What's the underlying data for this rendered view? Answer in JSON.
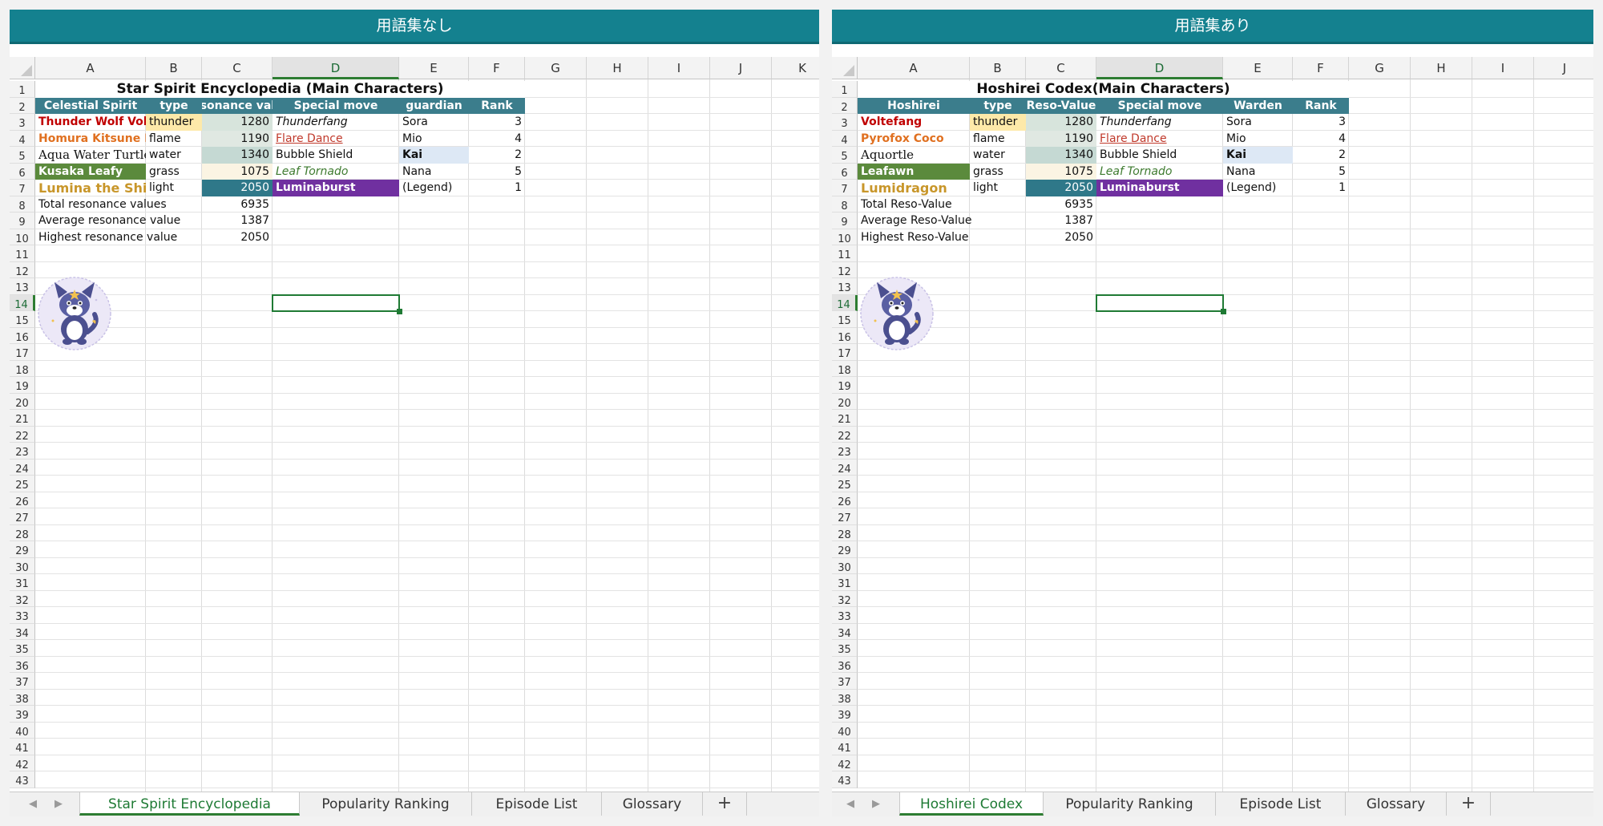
{
  "panels": [
    {
      "title": "用語集なし",
      "columns": [
        "A",
        "B",
        "C",
        "D",
        "E",
        "F",
        "G",
        "H",
        "I",
        "J",
        "K"
      ],
      "sheet_title": "Star Spirit Encyclopedia (Main Characters)",
      "headers": [
        "Celestial Spirit",
        "type",
        "Resonance value",
        "Special move",
        "guardian",
        "Rank"
      ],
      "rows": [
        {
          "name": "Thunder Wolf Voltefang",
          "type": "thunder",
          "value": "1280",
          "move": "Thunderfang",
          "guardian": "Sora",
          "rank": "3"
        },
        {
          "name": "Homura Kitsune Koko",
          "type": "flame",
          "value": "1190",
          "move": "Flare Dance",
          "guardian": "Mio",
          "rank": "4"
        },
        {
          "name": "Aqua Water Turtle",
          "type": "water",
          "value": "1340",
          "move": "Bubble Shield",
          "guardian": "Kai",
          "rank": "2"
        },
        {
          "name": "Kusaka Leafy",
          "type": "grass",
          "value": "1075",
          "move": "Leaf Tornado",
          "guardian": "Nana",
          "rank": "5"
        },
        {
          "name": "Lumina the Shining Dragon",
          "type": "light",
          "value": "2050",
          "move": "Luminaburst",
          "guardian": "(Legend)",
          "rank": "1"
        }
      ],
      "summary": [
        {
          "label": "Total resonance values",
          "value": "6935"
        },
        {
          "label": "Average resonance value",
          "value": "1387"
        },
        {
          "label": "Highest resonance value",
          "value": "2050"
        }
      ],
      "selected_column": "D",
      "selected_row": "14",
      "tabs": [
        "Star Spirit Encyclopedia",
        "Popularity Ranking",
        "Episode List",
        "Glossary"
      ],
      "add_tab_label": "+",
      "nav_prev": "◀",
      "nav_next": "▶"
    },
    {
      "title": "用語集あり",
      "columns": [
        "A",
        "B",
        "C",
        "D",
        "E",
        "F",
        "G",
        "H",
        "I",
        "J"
      ],
      "sheet_title": "Hoshirei Codex(Main Characters)",
      "headers": [
        "Hoshirei",
        "type",
        "Reso-Value",
        "Special move",
        "Warden",
        "Rank"
      ],
      "rows": [
        {
          "name": "Voltefang",
          "type": "thunder",
          "value": "1280",
          "move": "Thunderfang",
          "guardian": "Sora",
          "rank": "3"
        },
        {
          "name": "Pyrofox Coco",
          "type": "flame",
          "value": "1190",
          "move": "Flare Dance",
          "guardian": "Mio",
          "rank": "4"
        },
        {
          "name": "Aquortle",
          "type": "water",
          "value": "1340",
          "move": "Bubble Shield",
          "guardian": "Kai",
          "rank": "2"
        },
        {
          "name": "Leafawn",
          "type": "grass",
          "value": "1075",
          "move": "Leaf Tornado",
          "guardian": "Nana",
          "rank": "5"
        },
        {
          "name": "Lumidragon",
          "type": "light",
          "value": "2050",
          "move": "Luminaburst",
          "guardian": "(Legend)",
          "rank": "1"
        }
      ],
      "summary": [
        {
          "label": "Total Reso-Value",
          "value": "6935"
        },
        {
          "label": "Average Reso-Value",
          "value": "1387"
        },
        {
          "label": "Highest Reso-Value",
          "value": "2050"
        }
      ],
      "selected_column": "D",
      "selected_row": "14",
      "tabs": [
        "Hoshirei Codex",
        "Popularity Ranking",
        "Episode List",
        "Glossary"
      ],
      "add_tab_label": "+",
      "nav_prev": "◀",
      "nav_next": "▶"
    }
  ],
  "row_count": 43,
  "colors": {
    "title_bar": "#14818f",
    "header_row": "#3b7d8c",
    "thunder_text": "#c00000",
    "flame_text": "#e07020",
    "grass_fill": "#5b8a3c",
    "light_text": "#c8962a",
    "legend_fill": "#7030a0",
    "legend_value_fill": "#2f7889",
    "selection": "#1f7a34"
  },
  "icons": {
    "mascot": "star-wolf-mascot-icon"
  }
}
